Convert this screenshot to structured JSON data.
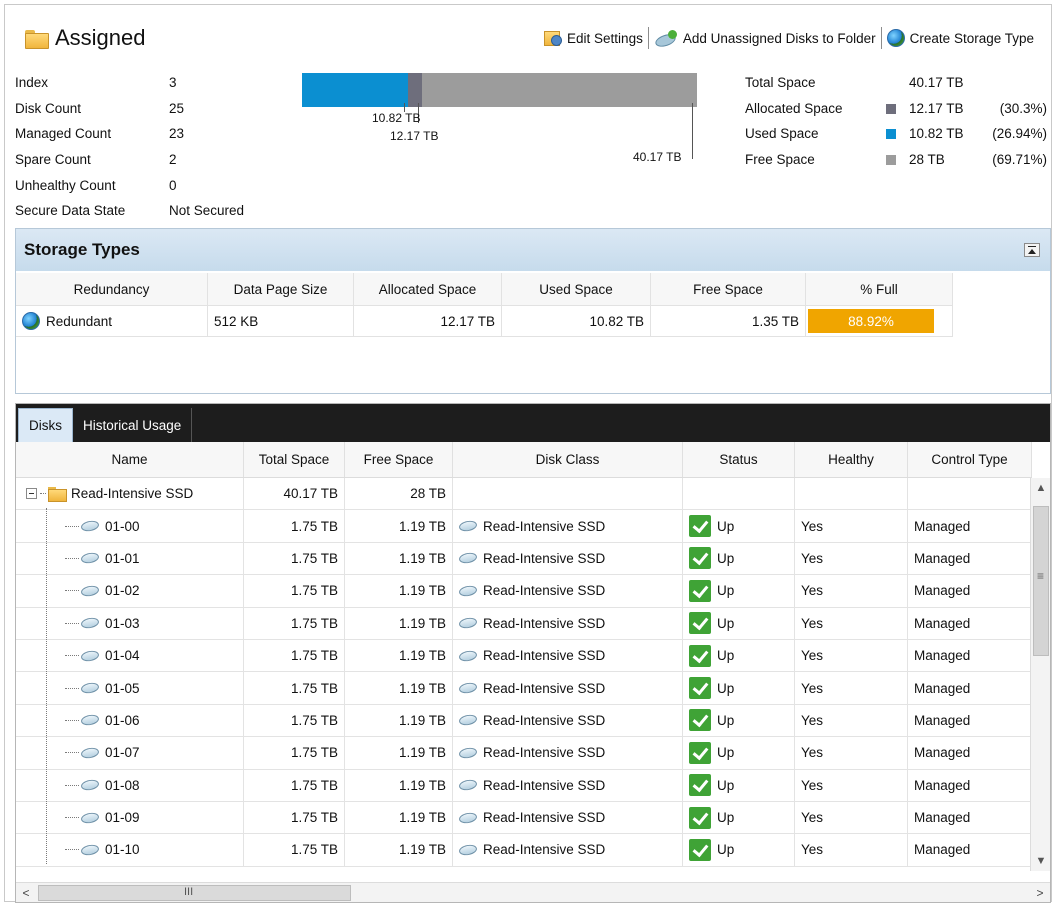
{
  "header": {
    "title": "Assigned",
    "toolbar": {
      "edit_settings": "Edit Settings",
      "add_unassigned": "Add Unassigned Disks to Folder",
      "create_storage_type": "Create Storage Type"
    }
  },
  "summary": {
    "stats": [
      {
        "label": "Index",
        "value": "3"
      },
      {
        "label": "Disk Count",
        "value": "25"
      },
      {
        "label": "Managed Count",
        "value": "23"
      },
      {
        "label": "Spare Count",
        "value": "2"
      },
      {
        "label": "Unhealthy Count",
        "value": "0"
      },
      {
        "label": "Secure Data State",
        "value": "Not Secured"
      }
    ],
    "usage_bar": {
      "total_tb": 40.17,
      "allocated_tb": 12.17,
      "used_tb": 10.82,
      "used_label": "10.82 TB",
      "allocated_label": "12.17 TB",
      "total_label": "40.17 TB",
      "colors": {
        "used": "#0b8fd1",
        "allocated": "#6e6e7c",
        "free": "#9c9c9c"
      }
    },
    "legend": {
      "total": {
        "label": "Total Space",
        "value": "40.17 TB"
      },
      "allocated": {
        "label": "Allocated Space",
        "value": "12.17 TB",
        "pct": "(30.3%)"
      },
      "used": {
        "label": "Used Space",
        "value": "10.82 TB",
        "pct": "(26.94%)"
      },
      "free": {
        "label": "Free Space",
        "value": "28 TB",
        "pct": "(69.71%)"
      }
    }
  },
  "storage_types": {
    "title": "Storage Types",
    "columns": [
      "Redundancy",
      "Data Page Size",
      "Allocated Space",
      "Used Space",
      "Free Space",
      "% Full"
    ],
    "rows": [
      {
        "redundancy": "Redundant",
        "page_size": "512 KB",
        "allocated": "12.17 TB",
        "used": "10.82 TB",
        "free": "1.35 TB",
        "pct_full": "88.92%"
      }
    ]
  },
  "disks": {
    "tabs": [
      "Disks",
      "Historical Usage"
    ],
    "columns": [
      "Name",
      "Total Space",
      "Free Space",
      "Disk Class",
      "Status",
      "Healthy",
      "Control Type"
    ],
    "folder": {
      "name": "Read-Intensive SSD",
      "total": "40.17 TB",
      "free": "28 TB"
    },
    "rows": [
      {
        "name": "01-00",
        "total": "1.75 TB",
        "free": "1.19 TB",
        "disk_class": "Read-Intensive SSD",
        "status": "Up",
        "healthy": "Yes",
        "control": "Managed"
      },
      {
        "name": "01-01",
        "total": "1.75 TB",
        "free": "1.19 TB",
        "disk_class": "Read-Intensive SSD",
        "status": "Up",
        "healthy": "Yes",
        "control": "Managed"
      },
      {
        "name": "01-02",
        "total": "1.75 TB",
        "free": "1.19 TB",
        "disk_class": "Read-Intensive SSD",
        "status": "Up",
        "healthy": "Yes",
        "control": "Managed"
      },
      {
        "name": "01-03",
        "total": "1.75 TB",
        "free": "1.19 TB",
        "disk_class": "Read-Intensive SSD",
        "status": "Up",
        "healthy": "Yes",
        "control": "Managed"
      },
      {
        "name": "01-04",
        "total": "1.75 TB",
        "free": "1.19 TB",
        "disk_class": "Read-Intensive SSD",
        "status": "Up",
        "healthy": "Yes",
        "control": "Managed"
      },
      {
        "name": "01-05",
        "total": "1.75 TB",
        "free": "1.19 TB",
        "disk_class": "Read-Intensive SSD",
        "status": "Up",
        "healthy": "Yes",
        "control": "Managed"
      },
      {
        "name": "01-06",
        "total": "1.75 TB",
        "free": "1.19 TB",
        "disk_class": "Read-Intensive SSD",
        "status": "Up",
        "healthy": "Yes",
        "control": "Managed"
      },
      {
        "name": "01-07",
        "total": "1.75 TB",
        "free": "1.19 TB",
        "disk_class": "Read-Intensive SSD",
        "status": "Up",
        "healthy": "Yes",
        "control": "Managed"
      },
      {
        "name": "01-08",
        "total": "1.75 TB",
        "free": "1.19 TB",
        "disk_class": "Read-Intensive SSD",
        "status": "Up",
        "healthy": "Yes",
        "control": "Managed"
      },
      {
        "name": "01-09",
        "total": "1.75 TB",
        "free": "1.19 TB",
        "disk_class": "Read-Intensive SSD",
        "status": "Up",
        "healthy": "Yes",
        "control": "Managed"
      },
      {
        "name": "01-10",
        "total": "1.75 TB",
        "free": "1.19 TB",
        "disk_class": "Read-Intensive SSD",
        "status": "Up",
        "healthy": "Yes",
        "control": "Managed"
      }
    ],
    "hscroll_grip": "III",
    "vscroll_grip": "≡"
  }
}
